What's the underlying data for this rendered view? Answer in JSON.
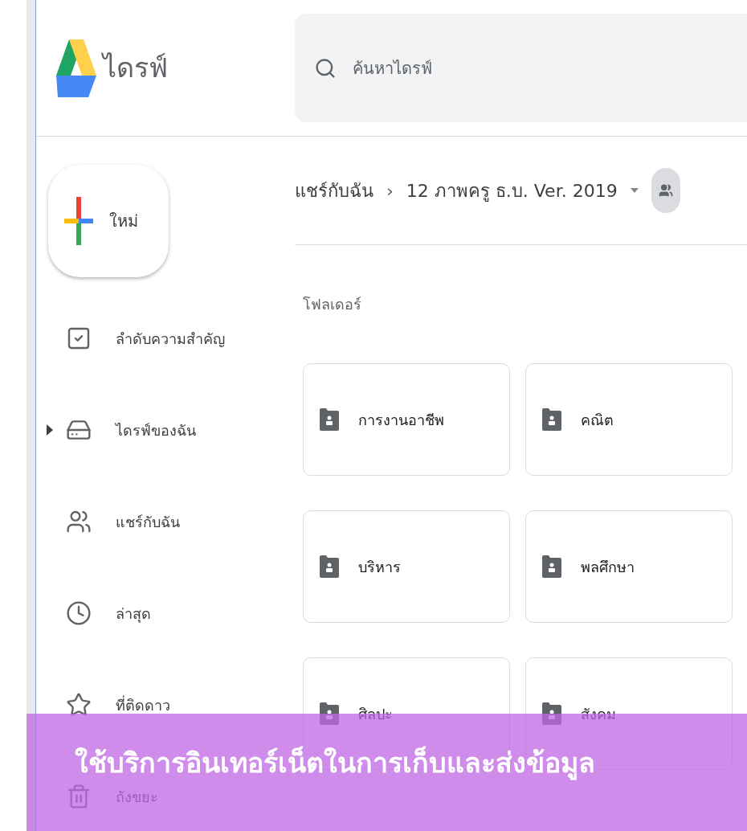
{
  "app": {
    "title": "ไดรฟ์"
  },
  "search": {
    "placeholder": "ค้นหาไดรฟ์"
  },
  "new_button": {
    "label": "ใหม่"
  },
  "sidebar": {
    "items": [
      {
        "label": "ลำดับความสำคัญ",
        "kind": "priority",
        "selected": false,
        "expandable": false
      },
      {
        "label": "ไดรฟ์ของฉัน",
        "kind": "drive",
        "selected": false,
        "expandable": true
      },
      {
        "label": "แชร์กับฉัน",
        "kind": "shared",
        "selected": false,
        "expandable": false
      },
      {
        "label": "ล่าสุด",
        "kind": "recent",
        "selected": false,
        "expandable": false
      },
      {
        "label": "ที่ติดดาว",
        "kind": "starred",
        "selected": false,
        "expandable": false
      },
      {
        "label": "ถังขยะ",
        "kind": "trash",
        "selected": false,
        "expandable": false
      }
    ]
  },
  "breadcrumb": {
    "separator": "›",
    "items": [
      "แชร์กับฉัน",
      "12 ภาพครู ธ.บ. Ver. 2019"
    ]
  },
  "section_title": "โฟลเดอร์",
  "folders": [
    {
      "name": "การงานอาชีพ"
    },
    {
      "name": "คณิต"
    },
    {
      "name": "บริหาร"
    },
    {
      "name": "พลศึกษา"
    },
    {
      "name": "ศิลปะ"
    },
    {
      "name": "สังคม"
    }
  ],
  "caption": "ใช้บริการอินเทอร์เน็ตในการเก็บและส่งข้อมูล"
}
